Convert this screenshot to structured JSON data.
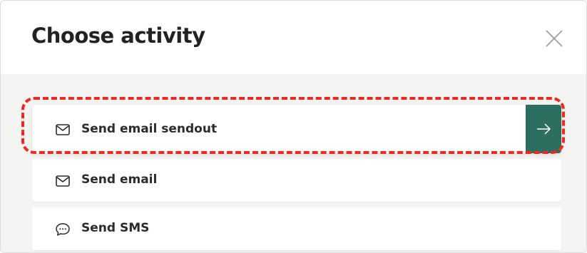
{
  "dialog": {
    "title": "Choose activity",
    "close_icon": "close-icon"
  },
  "activities": [
    {
      "label": "Send email sendout",
      "icon": "mail-icon",
      "selected": true,
      "action_icon": "arrow-right-icon"
    },
    {
      "label": "Send email",
      "icon": "mail-icon",
      "selected": false
    },
    {
      "label": "Send SMS",
      "icon": "chat-bubble-icon",
      "selected": false
    }
  ],
  "colors": {
    "accent": "#2c6e62",
    "highlight": "#f0291e",
    "list_background": "#f4f4f2"
  }
}
